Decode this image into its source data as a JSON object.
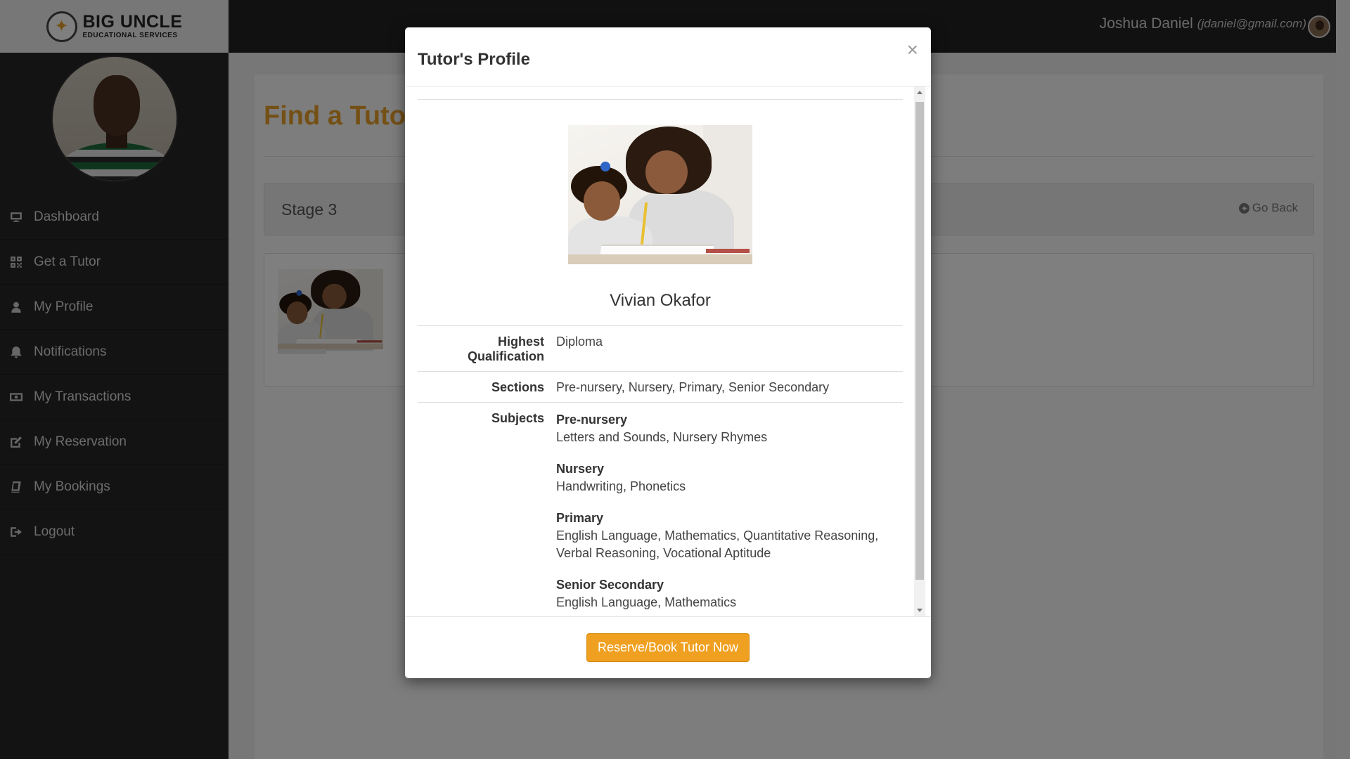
{
  "brand": {
    "logo_main": "BIG UNCLE",
    "logo_sub": "EDUCATIONAL SERVICES"
  },
  "sidebar": {
    "items": [
      {
        "label": "Dashboard",
        "icon": "monitor-icon"
      },
      {
        "label": "Get a Tutor",
        "icon": "qrcode-icon"
      },
      {
        "label": "My Profile",
        "icon": "user-icon"
      },
      {
        "label": "Notifications",
        "icon": "bell-icon"
      },
      {
        "label": "My Transactions",
        "icon": "money-icon"
      },
      {
        "label": "My Reservation",
        "icon": "edit-icon"
      },
      {
        "label": "My Bookings",
        "icon": "book-icon"
      },
      {
        "label": "Logout",
        "icon": "sign-out-icon"
      }
    ]
  },
  "topbar": {
    "user_name": "Joshua Daniel",
    "user_email": "(jdaniel@gmail.com)"
  },
  "main": {
    "page_title": "Find a Tutor",
    "stage_label": "Stage 3",
    "go_back_label": "Go Back"
  },
  "modal": {
    "title": "Tutor's Profile",
    "close_symbol": "×",
    "tutor_name": "Vivian Okafor",
    "highest_qualification_label": "Highest Qualification",
    "highest_qualification_value": "Diploma",
    "sections_label": "Sections",
    "sections_value": "Pre-nursery, Nursery, Primary, Senior Secondary",
    "subjects_label": "Subjects",
    "subjects": [
      {
        "section": "Pre-nursery",
        "list": "Letters and Sounds, Nursery Rhymes"
      },
      {
        "section": "Nursery",
        "list": "Handwriting, Phonetics"
      },
      {
        "section": "Primary",
        "list": "English Language, Mathematics, Quantitative Reasoning, Verbal Reasoning, Vocational Aptitude"
      },
      {
        "section": "Senior Secondary",
        "list": "English Language, Mathematics"
      }
    ],
    "reserve_button": "Reserve/Book Tutor Now"
  },
  "colors": {
    "accent": "#e8a12a",
    "button": "#f0a020",
    "sidebar_bg": "#262626",
    "topbar_bg": "#222222"
  }
}
